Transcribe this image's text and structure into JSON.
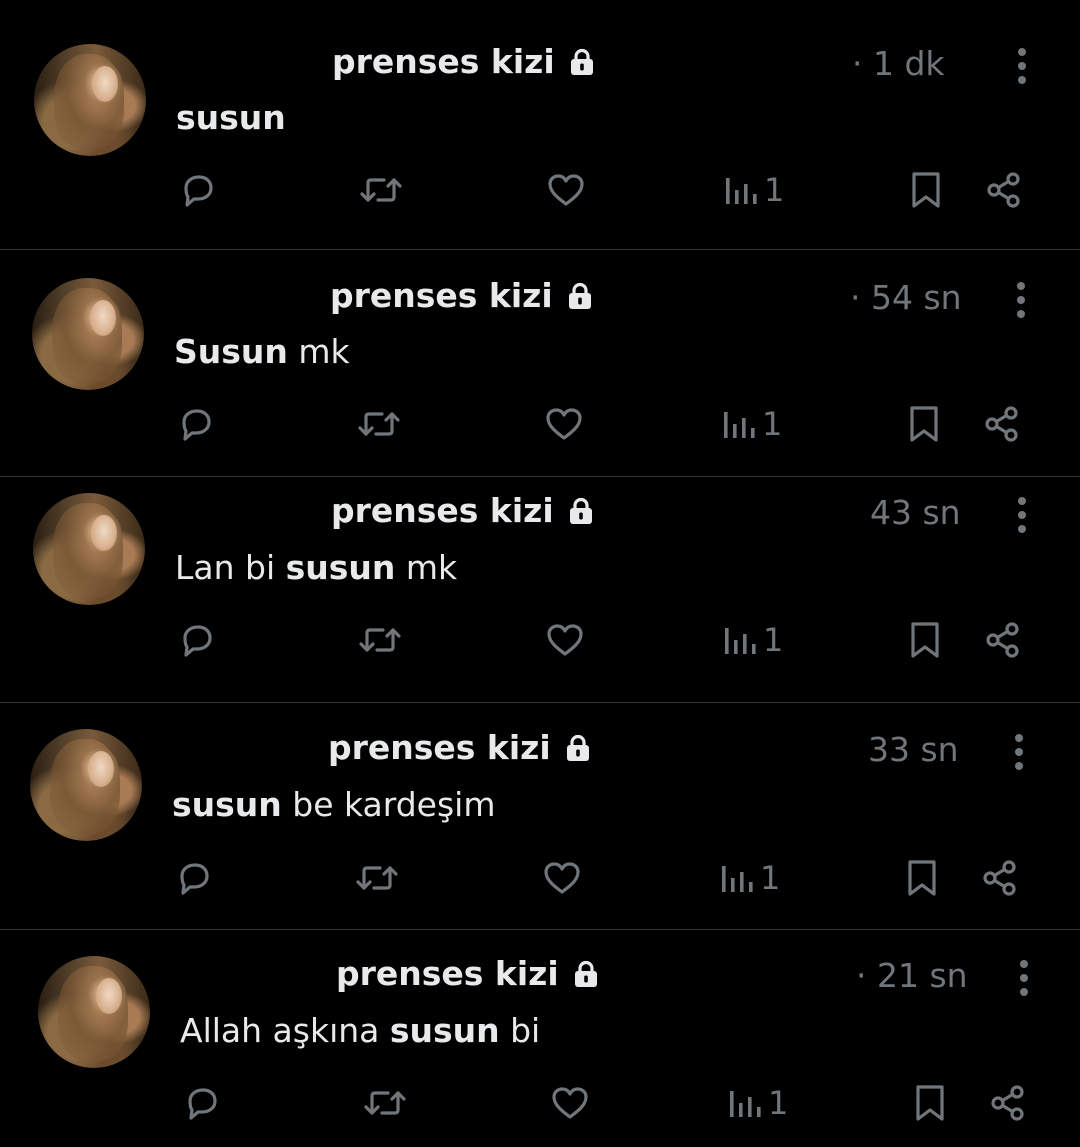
{
  "tweets": [
    {
      "author": "prenses kizi",
      "time": "· 1 dk",
      "text_parts": [
        {
          "text": "susun",
          "bold": true
        }
      ],
      "views": "1",
      "icons": [
        "lock-icon",
        "more-icon",
        "reply-icon",
        "retweet-icon",
        "like-icon",
        "views-icon",
        "bookmark-icon",
        "share-icon"
      ]
    },
    {
      "author": "prenses kizi",
      "time": "· 54 sn",
      "text_parts": [
        {
          "text": "Susun",
          "bold": true
        },
        {
          "text": " mk",
          "bold": false
        }
      ],
      "views": "1"
    },
    {
      "author": "prenses kizi",
      "time": "43 sn",
      "text_parts": [
        {
          "text": "Lan bi ",
          "bold": false
        },
        {
          "text": "susun",
          "bold": true
        },
        {
          "text": " mk",
          "bold": false
        }
      ],
      "views": "1"
    },
    {
      "author": "prenses kizi",
      "time": "33 sn",
      "text_parts": [
        {
          "text": "susun",
          "bold": true
        },
        {
          "text": " be kardeşim",
          "bold": false
        }
      ],
      "views": "1"
    },
    {
      "author": "prenses kizi",
      "time": "· 21 sn",
      "text_parts": [
        {
          "text": "Allah aşkına ",
          "bold": false
        },
        {
          "text": "susun",
          "bold": true
        },
        {
          "text": " bi",
          "bold": false
        }
      ],
      "views": "1"
    }
  ],
  "colors": {
    "background": "#000000",
    "text": "#e7e9ea",
    "muted": "#71767b",
    "divider": "#2f3336"
  }
}
